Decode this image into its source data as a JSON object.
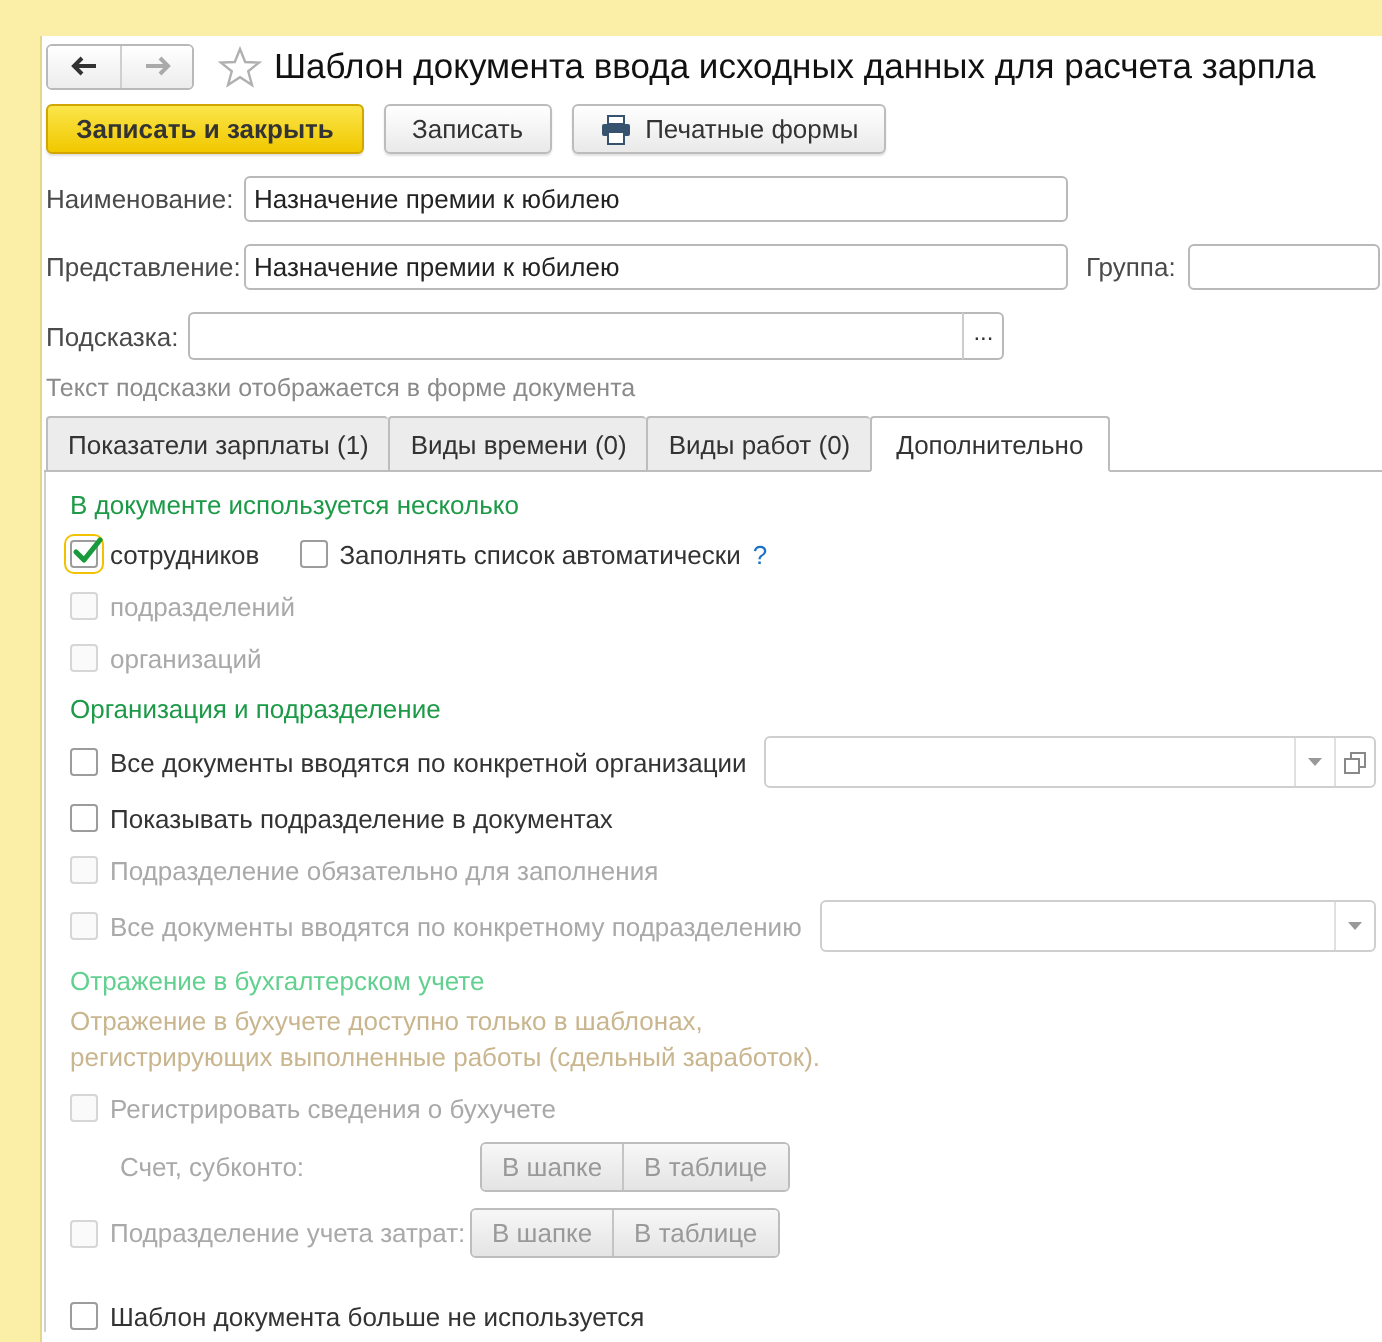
{
  "title": "Шаблон документа ввода исходных данных для расчета зарпла",
  "navigation": [
    {
      "kind": "back",
      "disabled": false
    },
    {
      "kind": "forward",
      "disabled": true
    }
  ],
  "buttons": [
    {
      "label": "Записать и закрыть",
      "kind": "primary"
    },
    {
      "label": "Записать",
      "kind": "normal"
    },
    {
      "label": "Печатные формы",
      "kind": "print"
    }
  ],
  "fields": [
    {
      "label": "Наименование:",
      "value": "Назначение премии к юбилею"
    },
    {
      "label": "Представление:",
      "value": "Назначение премии к юбилею",
      "extra": {
        "label": "Группа:"
      }
    }
  ],
  "hint_field": {
    "label": "Подсказка:",
    "button": "..."
  },
  "hint_note": "Текст подсказки отображается в форме документа",
  "tabs": [
    {
      "label": "Показатели зарплаты (1)",
      "selected": false
    },
    {
      "label": "Виды времени (0)",
      "selected": false
    },
    {
      "label": "Виды работ (0)",
      "selected": false
    },
    {
      "label": "Дополнительно",
      "selected": true
    }
  ],
  "content": [
    {
      "kind": "heading",
      "text": "В документе используется несколько",
      "disabled": false
    },
    {
      "kind": "checkbox",
      "label": "сотрудников",
      "checked": true,
      "disabled": false,
      "focused": true,
      "side": {
        "label": "Заполнять список автоматически",
        "checked": false,
        "help": "?"
      }
    },
    {
      "kind": "checkbox",
      "label": "подразделений",
      "checked": false,
      "disabled": true
    },
    {
      "kind": "checkbox",
      "label": "организаций",
      "checked": false,
      "disabled": true
    },
    {
      "kind": "heading",
      "text": "Организация и подразделение",
      "disabled": false
    },
    {
      "kind": "checkbox",
      "label": "Все документы вводятся по конкретной организации",
      "checked": false,
      "disabled": false,
      "combo": {
        "open_button": true
      }
    },
    {
      "kind": "checkbox",
      "label": "Показывать подразделение в документах",
      "checked": false,
      "disabled": false
    },
    {
      "kind": "checkbox",
      "label": "Подразделение обязательно для заполнения",
      "checked": false,
      "disabled": true
    },
    {
      "kind": "checkbox",
      "label": "Все документы вводятся по конкретному подразделению",
      "checked": false,
      "disabled": true,
      "combo": {
        "open_button": false
      }
    },
    {
      "kind": "heading",
      "text": "Отражение в бухгалтерском учете",
      "disabled": true
    },
    {
      "kind": "note",
      "text": "Отражение в бухучете доступно только в шаблонах, регистрирующих выполненные работы (сдельный заработок)."
    },
    {
      "kind": "checkbox",
      "label": "Регистрировать сведения о бухучете",
      "checked": false,
      "disabled": true
    },
    {
      "kind": "switch",
      "label": "Счет, субконто:",
      "disabled": true,
      "options": [
        {
          "label": "В шапке",
          "selected": false
        },
        {
          "label": "В таблице",
          "selected": false
        }
      ]
    },
    {
      "kind": "switch",
      "label": "Подразделение учета затрат:",
      "disabled": true,
      "checked": false,
      "options": [
        {
          "label": "В шапке",
          "selected": false
        },
        {
          "label": "В таблице",
          "selected": false
        }
      ]
    },
    {
      "kind": "checkbox",
      "label": "Шаблон документа больше не используется",
      "checked": false,
      "disabled": false
    }
  ]
}
